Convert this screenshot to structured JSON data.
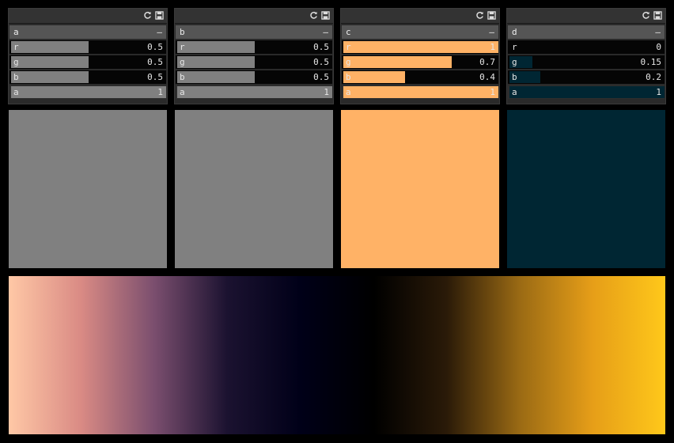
{
  "icons": {
    "refresh": "refresh-icon",
    "save": "save-icon"
  },
  "swatches": [
    {
      "name": "a",
      "collapse": "–",
      "r": "0.5",
      "g": "0.5",
      "b": "0.5",
      "a": "1",
      "r_frac": 0.5,
      "g_frac": 0.5,
      "b_frac": 0.5,
      "a_frac": 1,
      "color": "#808080"
    },
    {
      "name": "b",
      "collapse": "–",
      "r": "0.5",
      "g": "0.5",
      "b": "0.5",
      "a": "1",
      "r_frac": 0.5,
      "g_frac": 0.5,
      "b_frac": 0.5,
      "a_frac": 1,
      "color": "#808080"
    },
    {
      "name": "c",
      "collapse": "–",
      "r": "1",
      "g": "0.7",
      "b": "0.4",
      "a": "1",
      "r_frac": 1,
      "g_frac": 0.7,
      "b_frac": 0.4,
      "a_frac": 1,
      "color": "#ffb266"
    },
    {
      "name": "d",
      "collapse": "–",
      "r": "0",
      "g": "0.15",
      "b": "0.2",
      "a": "1",
      "r_frac": 0,
      "g_frac": 0.15,
      "b_frac": 0.2,
      "a_frac": 1,
      "color": "#002633"
    }
  ],
  "channel_labels": {
    "r": "r",
    "g": "g",
    "b": "b",
    "a": "a"
  },
  "gradient_stops": [
    "#ffc8a6",
    "#d98a84",
    "#7a4e6e",
    "#1b1230",
    "#000018",
    "#000000",
    "#2a1a08",
    "#9a6a14",
    "#e69e18",
    "#ffc81a"
  ]
}
